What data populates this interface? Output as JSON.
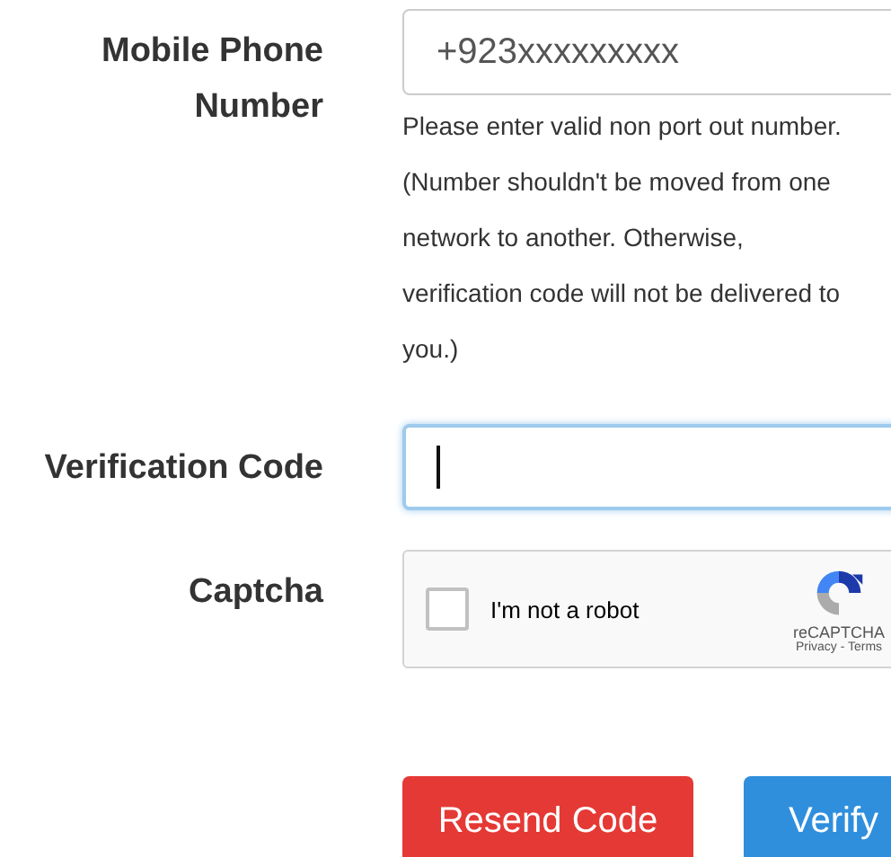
{
  "fields": [
    {
      "kind": "phone",
      "label": "Mobile Phone Number",
      "value": "+923xxxxxxxxx",
      "focused": false,
      "help": "Please enter valid non port out number. (Number shouldn't be moved from one network to another. Otherwise, verification code will not be delivered to you.)"
    },
    {
      "kind": "code",
      "label": "Verification Code",
      "focused": true
    },
    {
      "kind": "captcha",
      "label": "Captcha",
      "checkbox_label": "I'm not a robot",
      "checked": false,
      "brand": "reCAPTCHA",
      "links": "Privacy - Terms"
    }
  ],
  "buttons": [
    {
      "label": "Resend Code",
      "kind": "danger"
    },
    {
      "label": "Verify",
      "kind": "primary"
    }
  ]
}
